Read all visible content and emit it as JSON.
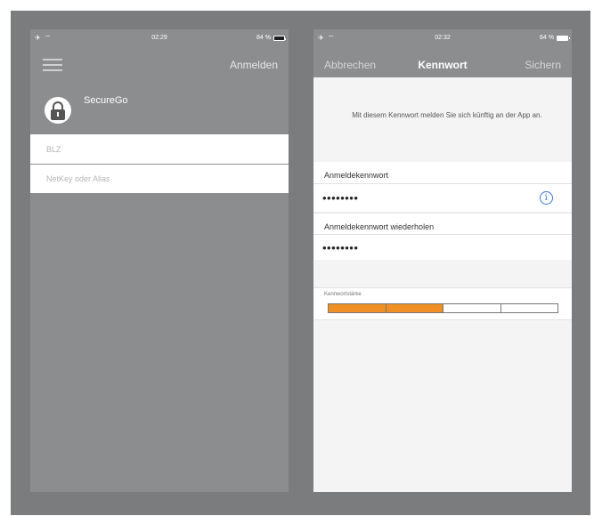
{
  "left_screen": {
    "status": {
      "signal": "✈ ⌔",
      "time": "02:29",
      "battery": "84 %"
    },
    "header": {
      "login_label": "Anmelden"
    },
    "app_name": "SecureGo",
    "fields": [
      {
        "placeholder": "BLZ"
      },
      {
        "placeholder": "NetKey oder Alias"
      }
    ]
  },
  "right_screen": {
    "status": {
      "signal": "✈ ⌔",
      "time": "02:32",
      "battery": "84 %"
    },
    "navbar": {
      "cancel_label": "Abbrechen",
      "title": "Kennwort",
      "save_label": "Sichern"
    },
    "info_text": "Mit diesem Kennwort melden Sie sich künftig an der App an.",
    "password": {
      "label": "Anmeldekennwort",
      "value": "••••••••"
    },
    "password_repeat": {
      "label": "Anmeldekennwort wiederholen",
      "value": "••••••••"
    },
    "strength": {
      "label": "Kennwortstärke",
      "filled_segments": 2,
      "total_segments": 4
    },
    "colors": {
      "strength_fill": "#ef8f24",
      "info_icon": "#3a78d6"
    }
  }
}
